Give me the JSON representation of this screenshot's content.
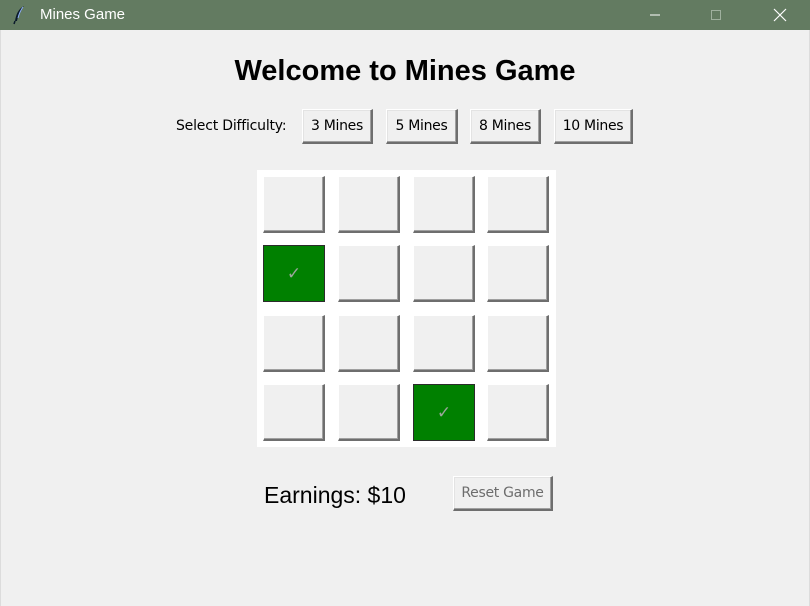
{
  "window": {
    "title": "Mines Game",
    "icon": "feather-icon",
    "titlebar_color": "#637b61"
  },
  "header": {
    "title": "Welcome to Mines Game"
  },
  "difficulty": {
    "label": "Select Difficulty:",
    "options": [
      "3 Mines",
      "5 Mines",
      "8 Mines",
      "10 Mines"
    ]
  },
  "grid": {
    "rows": 4,
    "cols": 4,
    "revealed_color": "#008000",
    "revealed_mark": "✓",
    "cells": [
      [
        "",
        "",
        "",
        ""
      ],
      [
        "✓",
        "",
        "",
        ""
      ],
      [
        "",
        "",
        "",
        ""
      ],
      [
        "",
        "",
        "✓",
        ""
      ]
    ]
  },
  "footer": {
    "earnings": "Earnings: $10",
    "reset_label": "Reset Game"
  }
}
